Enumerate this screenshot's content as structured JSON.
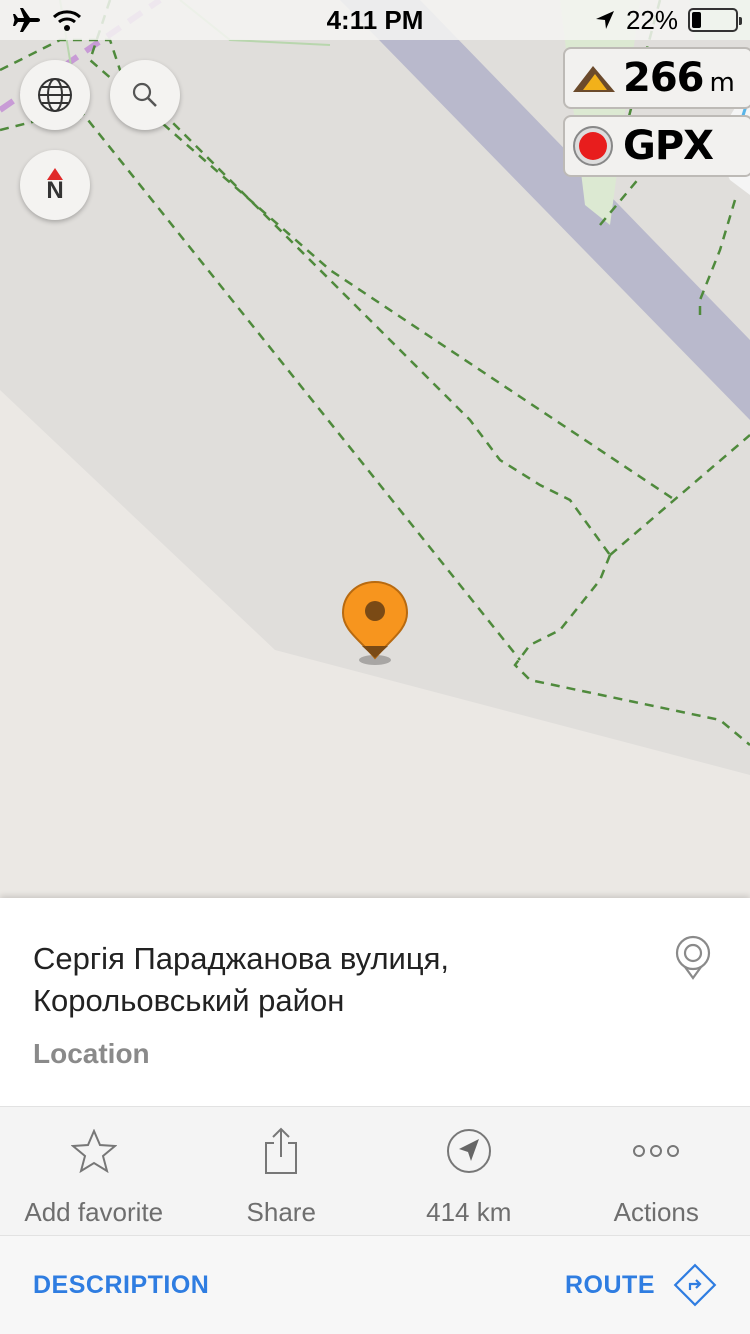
{
  "status_bar": {
    "time": "4:11 PM",
    "battery": "22%",
    "battery_level": 0.22,
    "icons": [
      "airplane-icon",
      "wifi-icon",
      "location-arrow-icon",
      "battery-icon"
    ]
  },
  "map_controls": {
    "buttons": [
      "globe-icon",
      "search-icon",
      "compass-north-icon"
    ],
    "compass_label": "N"
  },
  "widgets": {
    "altitude_value": "266",
    "altitude_unit": "m",
    "gpx_label": "GPX"
  },
  "place": {
    "title_line1": "Сергія Параджанова вулиця,",
    "title_line2": "Корольовський район",
    "type": "Location"
  },
  "actions": [
    {
      "label": "Add favorite",
      "icon": "star-icon"
    },
    {
      "label": "Share",
      "icon": "share-icon"
    },
    {
      "label": "414 km",
      "icon": "direction-arrow-icon"
    },
    {
      "label": "Actions",
      "icon": "more-dots-icon"
    }
  ],
  "footer": {
    "description_label": "DESCRIPTION",
    "route_label": "ROUTE"
  },
  "colors": {
    "accent": "#2f7de1",
    "marker": "#f5941f",
    "path_green": "#4f8a3c",
    "road_purple": "#b4b6cc"
  }
}
